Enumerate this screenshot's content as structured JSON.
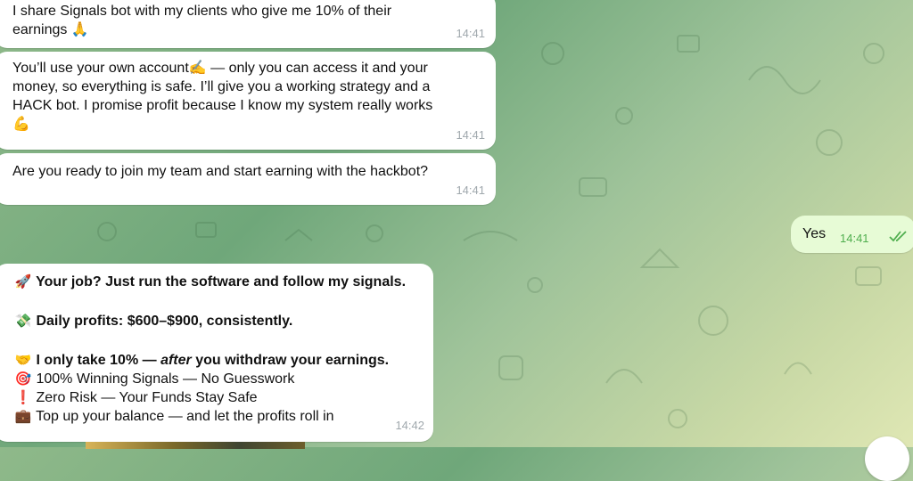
{
  "messages": {
    "m1": {
      "lines": [
        "I share Signals bot with my clients who give me 10% of their",
        "earnings 🙏"
      ],
      "time": "14:41"
    },
    "m2": {
      "lines": [
        "You’ll use your own account✍️ — only you can access it and your",
        "money, so everything is safe. I’ll give you a working strategy and a",
        "HACK bot. I promise profit because I know my system really works",
        "💪"
      ],
      "time": "14:41"
    },
    "m3": {
      "text": "Are you ready to join my team and start earning with the hackbot?",
      "time": "14:41"
    },
    "outgoing": {
      "text": "Yes",
      "time": "14:41"
    },
    "m4": {
      "line1_icon": "🚀",
      "line1": "Your job? Just run the software and follow my signals.",
      "line2_icon": "💸",
      "line2": "Daily profits: $600–$900, consistently.",
      "line3_icon": "🤝",
      "line3_a": "I only take 10% — ",
      "line3_b": "after",
      "line3_c": " you withdraw your earnings.",
      "line4_icon": "🎯",
      "line4": "100% Winning Signals — No Guesswork",
      "line5_icon": "❗",
      "line5": "Zero Risk — Your Funds Stay Safe",
      "line6_icon": "💼",
      "line6": "Top up your balance — and let the profits roll in",
      "time": "14:42"
    }
  },
  "colors": {
    "bubble_in": "#ffffff",
    "bubble_out": "#e7fbd6",
    "time_out": "#4fae4e"
  },
  "icons": {
    "read_receipt": "double-check-icon"
  }
}
